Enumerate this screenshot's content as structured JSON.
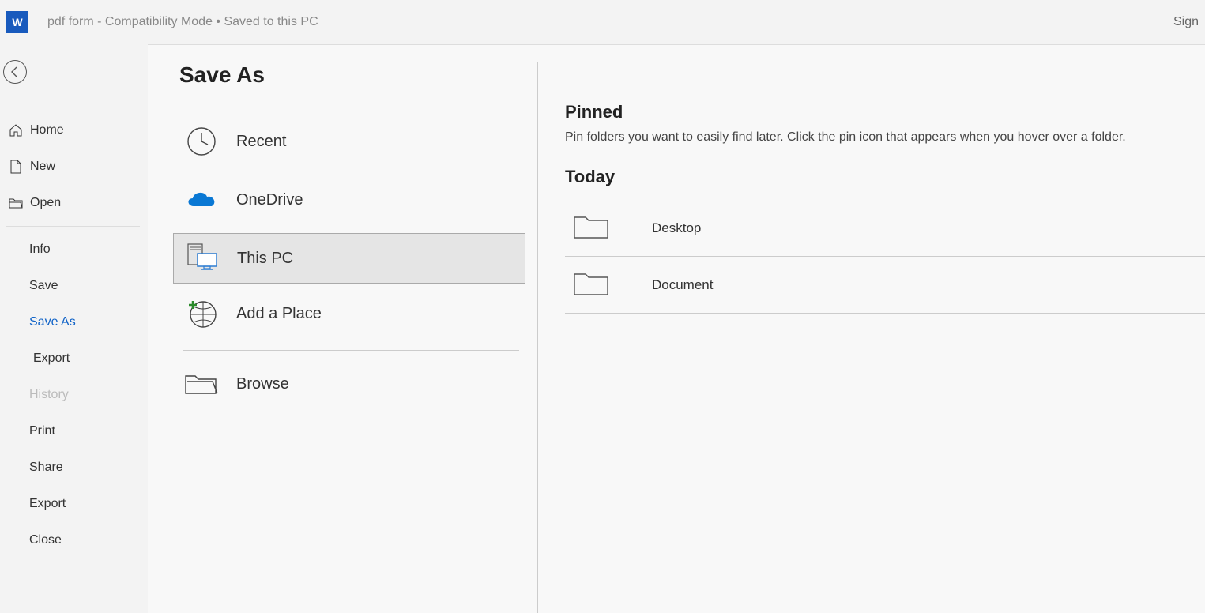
{
  "titlebar": {
    "doc_title": "pdf form  -  Compatibility Mode • Saved to this PC",
    "sign_in": "Sign"
  },
  "nav": {
    "home": "Home",
    "new": "New",
    "open": "Open",
    "info": "Info",
    "save": "Save",
    "save_as": "Save As",
    "export_sub": "Export",
    "history": "History",
    "print": "Print",
    "share": "Share",
    "export": "Export",
    "close": "Close"
  },
  "main": {
    "title": "Save As",
    "locations": {
      "recent": "Recent",
      "onedrive": "OneDrive",
      "this_pc": "This PC",
      "add_place": "Add a Place",
      "browse": "Browse"
    }
  },
  "detail": {
    "pinned_header": "Pinned",
    "pinned_hint": "Pin folders you want to easily find later. Click the pin icon that appears when you hover over a folder.",
    "today_header": "Today",
    "folders": [
      {
        "name": "Desktop"
      },
      {
        "name": "Document"
      }
    ]
  }
}
